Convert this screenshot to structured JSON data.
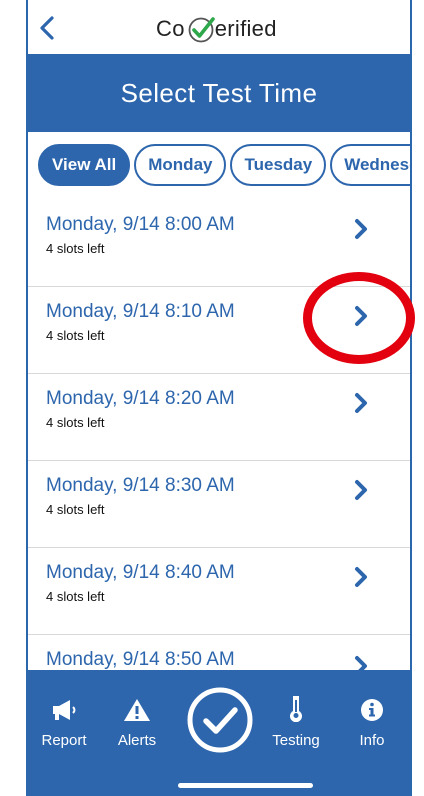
{
  "app": {
    "logo_left": "Co",
    "logo_right": "erified"
  },
  "header": {
    "title": "Select Test Time"
  },
  "filters": [
    "View All",
    "Monday",
    "Tuesday",
    "Wednesda"
  ],
  "slots": [
    {
      "time": "Monday, 9/14 8:00 AM",
      "availability": "4 slots left"
    },
    {
      "time": "Monday, 9/14 8:10 AM",
      "availability": "4 slots left"
    },
    {
      "time": "Monday, 9/14 8:20 AM",
      "availability": "4 slots left"
    },
    {
      "time": "Monday, 9/14 8:30 AM",
      "availability": "4 slots left"
    },
    {
      "time": "Monday, 9/14 8:40 AM",
      "availability": "4 slots left"
    },
    {
      "time": "Monday, 9/14 8:50 AM",
      "availability": ""
    }
  ],
  "tabbar": {
    "report": "Report",
    "alerts": "Alerts",
    "testing": "Testing",
    "info": "Info"
  },
  "colors": {
    "brand": "#2d66ad",
    "check_green": "#2ea84a",
    "annotation": "#e3000f"
  },
  "icons": {
    "back": "chevron-left-icon",
    "row": "chevron-right-icon",
    "report": "megaphone-icon",
    "alerts": "warning-icon",
    "center": "check-circle-icon",
    "testing": "thermometer-icon",
    "info": "info-icon"
  }
}
